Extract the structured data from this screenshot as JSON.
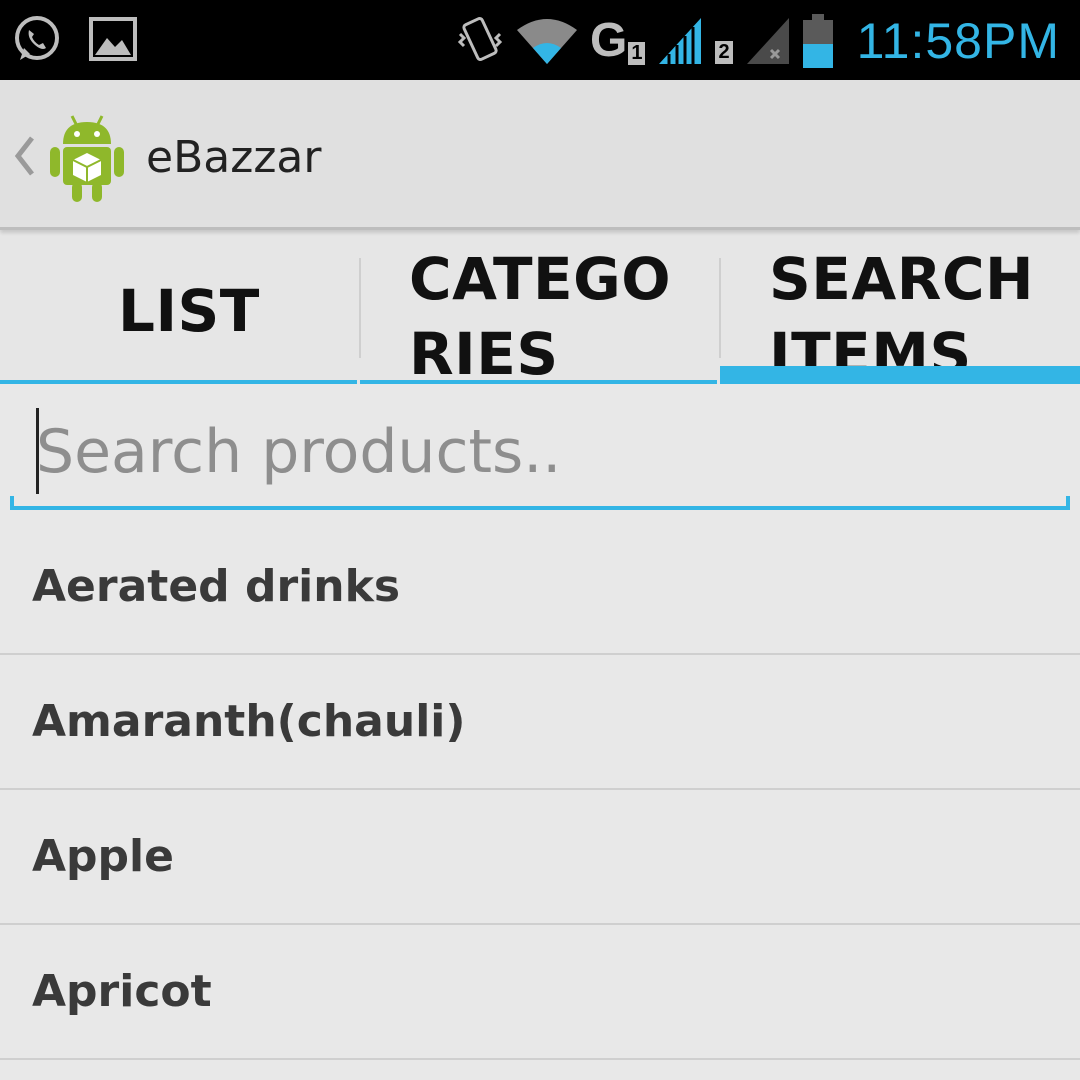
{
  "status_bar": {
    "time": "11:58PM",
    "network_label": "G",
    "sim1": "1",
    "sim2": "2",
    "accent_color": "#33b5e5",
    "icons": [
      "whatsapp-icon",
      "gallery-icon",
      "vibrate-icon",
      "wifi-icon",
      "signal-icon",
      "signal-no-service-icon",
      "battery-icon"
    ]
  },
  "action_bar": {
    "title": "eBazzar",
    "icons": [
      "up-caret-icon",
      "android-app-icon"
    ]
  },
  "tabs": [
    {
      "label_line1": "LIST",
      "label_line2": "",
      "selected": false
    },
    {
      "label_line1": "CATEGO",
      "label_line2": "RIES",
      "selected": false
    },
    {
      "label_line1": "SEARCH",
      "label_line2": "ITEMS",
      "selected": true
    }
  ],
  "search": {
    "placeholder": "Search products..",
    "value": ""
  },
  "products": [
    "Aerated drinks",
    "Amaranth(chauli)",
    "Apple",
    "Apricot"
  ]
}
